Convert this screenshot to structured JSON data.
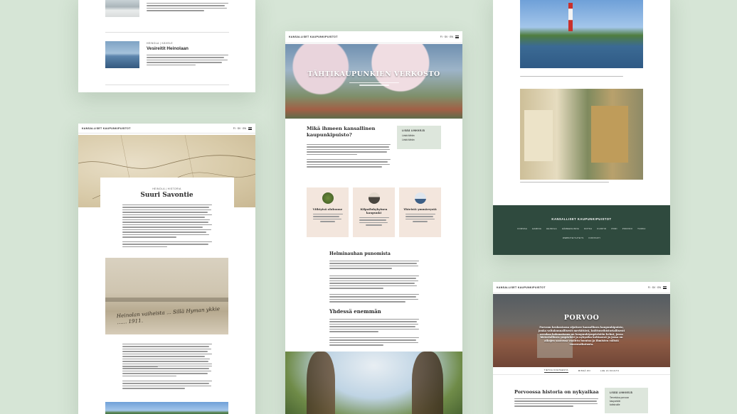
{
  "brand": "KANSALLISET KAUPUNKIPUISTOT",
  "header_tools": "FI · SV · EN",
  "colors": {
    "background": "#d6e5d6",
    "dark_green": "#2f4a3e",
    "beige": "#f3e6dd",
    "sidebar_box": "#dde6dc"
  },
  "card_top_left": {
    "article_eyebrow": "HEINOLA | KÄVELE",
    "article_title": "Vesireitit Heinolaan"
  },
  "card_savontie": {
    "eyebrow": "HEINOLA | HISTORIA",
    "title": "Suuri Savontie",
    "photo_caption_script": "Heinolan vaiheista ... Sillä Hyman ykkie ...... 1911."
  },
  "card_center": {
    "hero_title": "TÄHTIKAUPUNKIEN VERKOSTO",
    "intro_title": "Mikä ihmeen kansallinen kaupunkipuisto?",
    "sidebar_title": "LISÄÄ LINKKEJÄ",
    "sidebar_links": [
      "Linkki tähän",
      "Linkki tähän"
    ],
    "feature_cards": [
      {
        "title": "Viihtyisä olohuone",
        "icon": "tree-icon"
      },
      {
        "title": "Kilpailukykyinen kaupunki",
        "icon": "mountain-icon"
      },
      {
        "title": "Yhteistä ymmärrystä",
        "icon": "mosque-icon"
      }
    ],
    "section_1_title": "Helminauhan punomista",
    "section_2_title": "Yhdessä enemmän"
  },
  "card_right_top": {
    "footer_brand": "KANSALLISET KAUPUNKIPUISTOT",
    "footer_links_row1": [
      "FORSSA",
      "HAMINA",
      "HEINOLA",
      "HÄMEENLINNA",
      "KOTKA",
      "KUOPIO",
      "PORI",
      "PORVOO",
      "TURKU"
    ],
    "footer_links_row2": [
      "WEBSITE/YHTEYS",
      "KONTAKTI"
    ]
  },
  "card_porvoo": {
    "hero_title": "PORVOO",
    "hero_text": "Porvoon keskustassa sijaitsee kansallinen kaupunkipuisto, jonka valtakunnallisesti merkittävä, kulttuurihistoriallisesti arvokas kokonaisuus on kaupunkiympäristön helmi, jossa historiallinen ympäristö ja nykyaika kohtaavat ja jossa on aikojen saatossa vaalittu luontoa ja ihmisten välistä vuorovaikutusta.",
    "tabs": [
      "TIETOA KOHTEESTA",
      "MISSÄ ON",
      "LUE JA KUULTU"
    ],
    "section_title": "Porvoossa historia on nykyaikaa",
    "sidebar_title": "LISÄÄ LINKKEJÄ",
    "sidebar_links": [
      "Tervetuloa porvoon",
      "kaupunkiin",
      "kotisivuille"
    ]
  }
}
